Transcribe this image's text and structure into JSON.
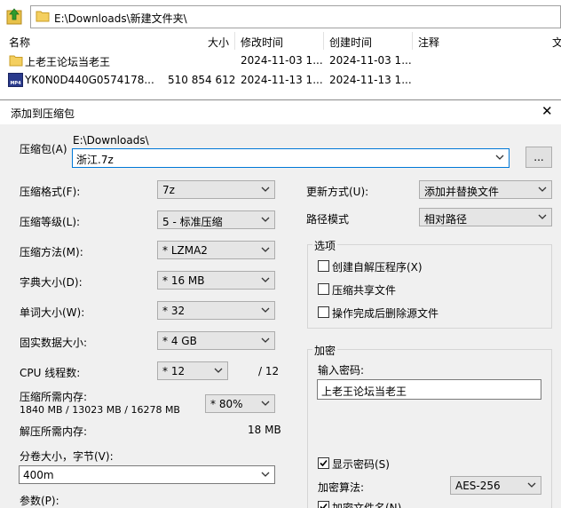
{
  "file_manager": {
    "address": "E:\\Downloads\\新建文件夹\\",
    "columns": [
      "名称",
      "大小",
      "修改时间",
      "创建时间",
      "注释",
      "文"
    ],
    "rows": [
      {
        "name": "上老王论坛当老王",
        "size": "",
        "modified": "2024-11-03 1...",
        "created": "2024-11-03 1...",
        "type": "folder"
      },
      {
        "name": "YK0N0D440G0574178...",
        "size": "510 854 612",
        "modified": "2024-11-13 1...",
        "created": "2024-11-13 1...",
        "type": "mp4"
      }
    ],
    "mp4_badge": "MP4"
  },
  "dialog": {
    "title": "添加到压缩包",
    "archive": {
      "label": "压缩包(A)",
      "path": "E:\\Downloads\\",
      "value": "浙江.7z",
      "browse": "..."
    },
    "left": {
      "format": {
        "label": "压缩格式(F):",
        "value": "7z"
      },
      "level": {
        "label": "压缩等级(L):",
        "value": "5 - 标准压缩"
      },
      "method": {
        "label": "压缩方法(M):",
        "value": "* LZMA2"
      },
      "dict": {
        "label": "字典大小(D):",
        "value": "* 16 MB"
      },
      "word": {
        "label": "单词大小(W):",
        "value": "* 32"
      },
      "solid": {
        "label": "固实数据大小:",
        "value": "* 4 GB"
      },
      "cpu": {
        "label": "CPU 线程数:",
        "value": "* 12",
        "max": "/ 12"
      },
      "mem_comp": {
        "label": "压缩所需内存:",
        "detail": "1840 MB / 13023 MB / 16278 MB",
        "value": "* 80%"
      },
      "mem_decomp": {
        "label": "解压所需内存:",
        "value": "18 MB"
      },
      "volume": {
        "label": "分卷大小，字节(V):",
        "value": "400m"
      },
      "params": {
        "label": "参数(P):"
      }
    },
    "right": {
      "update": {
        "label": "更新方式(U):",
        "value": "添加并替换文件"
      },
      "pathmode": {
        "label": "路径模式",
        "value": "相对路径"
      },
      "options": {
        "title": "选项",
        "items": [
          {
            "label": "创建自解压程序(X)",
            "checked": false
          },
          {
            "label": "压缩共享文件",
            "checked": false
          },
          {
            "label": "操作完成后删除源文件",
            "checked": false
          }
        ]
      },
      "encryption": {
        "title": "加密",
        "password_label": "输入密码:",
        "password": "上老王论坛当老王",
        "show_password": "显示密码(S)",
        "method_label": "加密算法:",
        "method": "AES-256",
        "encrypt_names": "加密文件名(N)"
      }
    }
  }
}
